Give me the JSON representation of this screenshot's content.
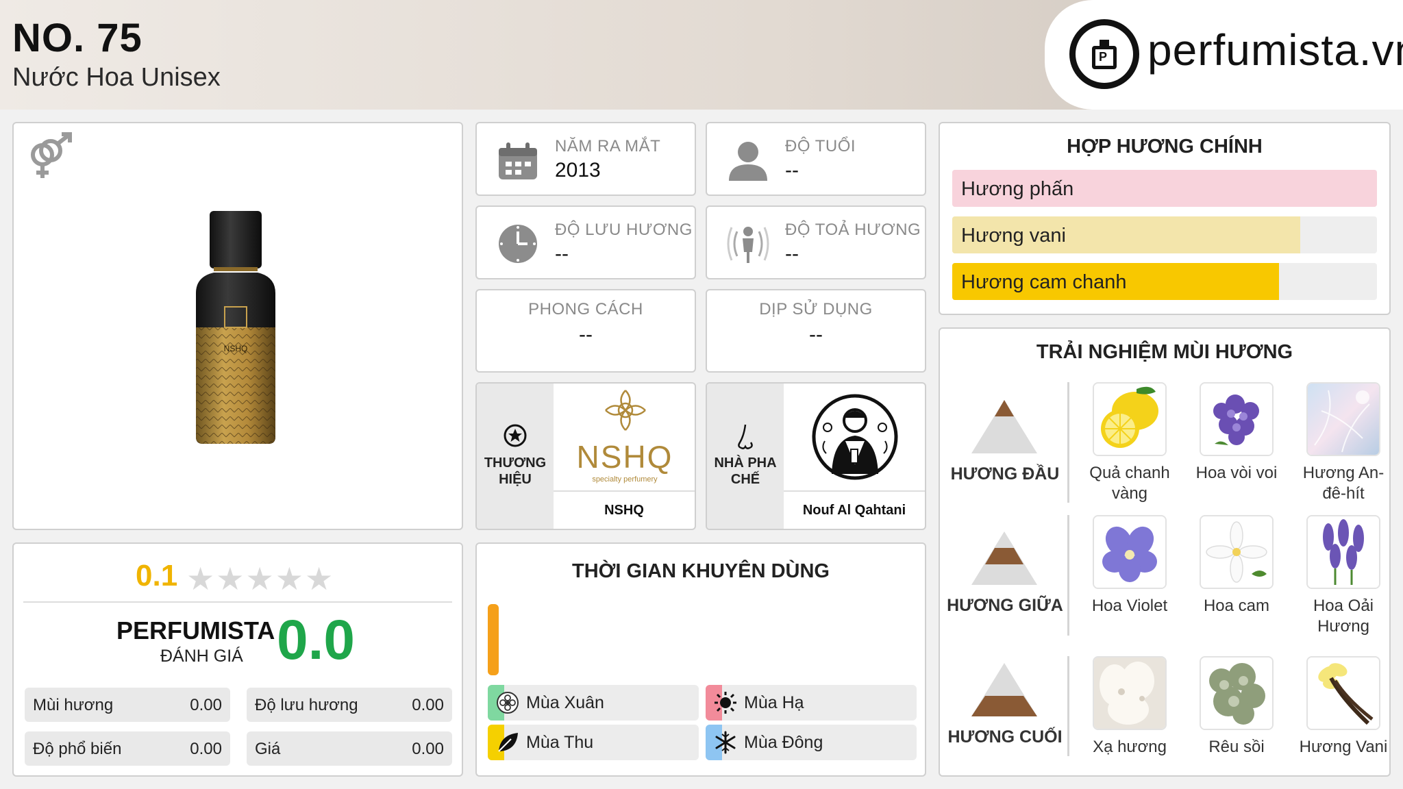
{
  "header": {
    "title": "NO. 75",
    "subtitle": "Nước Hoa Unisex",
    "logo_text": "perfumista.vn"
  },
  "info": {
    "release_year": {
      "label": "NĂM RA MẮT",
      "value": "2013"
    },
    "age": {
      "label": "ĐỘ TUỔI",
      "value": "--"
    },
    "longevity": {
      "label": "ĐỘ LƯU HƯƠNG",
      "value": "--"
    },
    "sillage": {
      "label": "ĐỘ TOẢ HƯƠNG",
      "value": "--"
    },
    "style": {
      "label": "PHONG CÁCH",
      "value": "--"
    },
    "occasion": {
      "label": "DỊP SỬ DỤNG",
      "value": "--"
    }
  },
  "brand": {
    "side_label_1": "THƯƠNG",
    "side_label_2": "HIỆU",
    "logo_main": "NSHQ",
    "logo_sub": "specialty perfumery",
    "name": "NSHQ"
  },
  "perfumer": {
    "side_label_1": "NHÀ PHA",
    "side_label_2": "CHẾ",
    "name": "Nouf Al Qahtani"
  },
  "accords": {
    "title": "HỢP HƯƠNG CHÍNH",
    "items": [
      {
        "label": "Hương phấn",
        "percent": 100,
        "color": "#f8d3dc"
      },
      {
        "label": "Hương vani",
        "percent": 82,
        "color": "#f3e5ab"
      },
      {
        "label": "Hương cam chanh",
        "percent": 77,
        "color": "#f8c800"
      }
    ]
  },
  "notes": {
    "title": "TRẢI NGHIỆM MÙI HƯƠNG",
    "tiers": [
      {
        "label": "HƯƠNG ĐẦU",
        "notes": [
          "Quả chanh vàng",
          "Hoa vòi voi",
          "Hương An-đê-hít"
        ]
      },
      {
        "label": "HƯƠNG GIỮA",
        "notes": [
          "Hoa Violet",
          "Hoa cam",
          "Hoa Oải Hương"
        ]
      },
      {
        "label": "HƯƠNG CUỐI",
        "notes": [
          "Xạ hương",
          "Rêu sồi",
          "Hương Vani"
        ]
      }
    ]
  },
  "rating": {
    "user_score": "0.1",
    "stars_filled": 0,
    "perfumista_label": "PERFUMISTA",
    "perfumista_sub": "ĐÁNH GIÁ",
    "perfumista_score": "0.0",
    "metrics": [
      {
        "label": "Mùi hương",
        "value": "0.00"
      },
      {
        "label": "Độ lưu hương",
        "value": "0.00"
      },
      {
        "label": "Độ phổ biến",
        "value": "0.00"
      },
      {
        "label": "Giá",
        "value": "0.00"
      }
    ]
  },
  "seasons": {
    "title": "THỜI GIAN KHUYÊN DÙNG",
    "items": [
      {
        "label": "Mùa Xuân",
        "color": "#7fd8a0"
      },
      {
        "label": "Mùa Hạ",
        "color": "#f28b9a"
      },
      {
        "label": "Mùa Thu",
        "color": "#f5d000"
      },
      {
        "label": "Mùa Đông",
        "color": "#8ec5f2"
      }
    ]
  }
}
